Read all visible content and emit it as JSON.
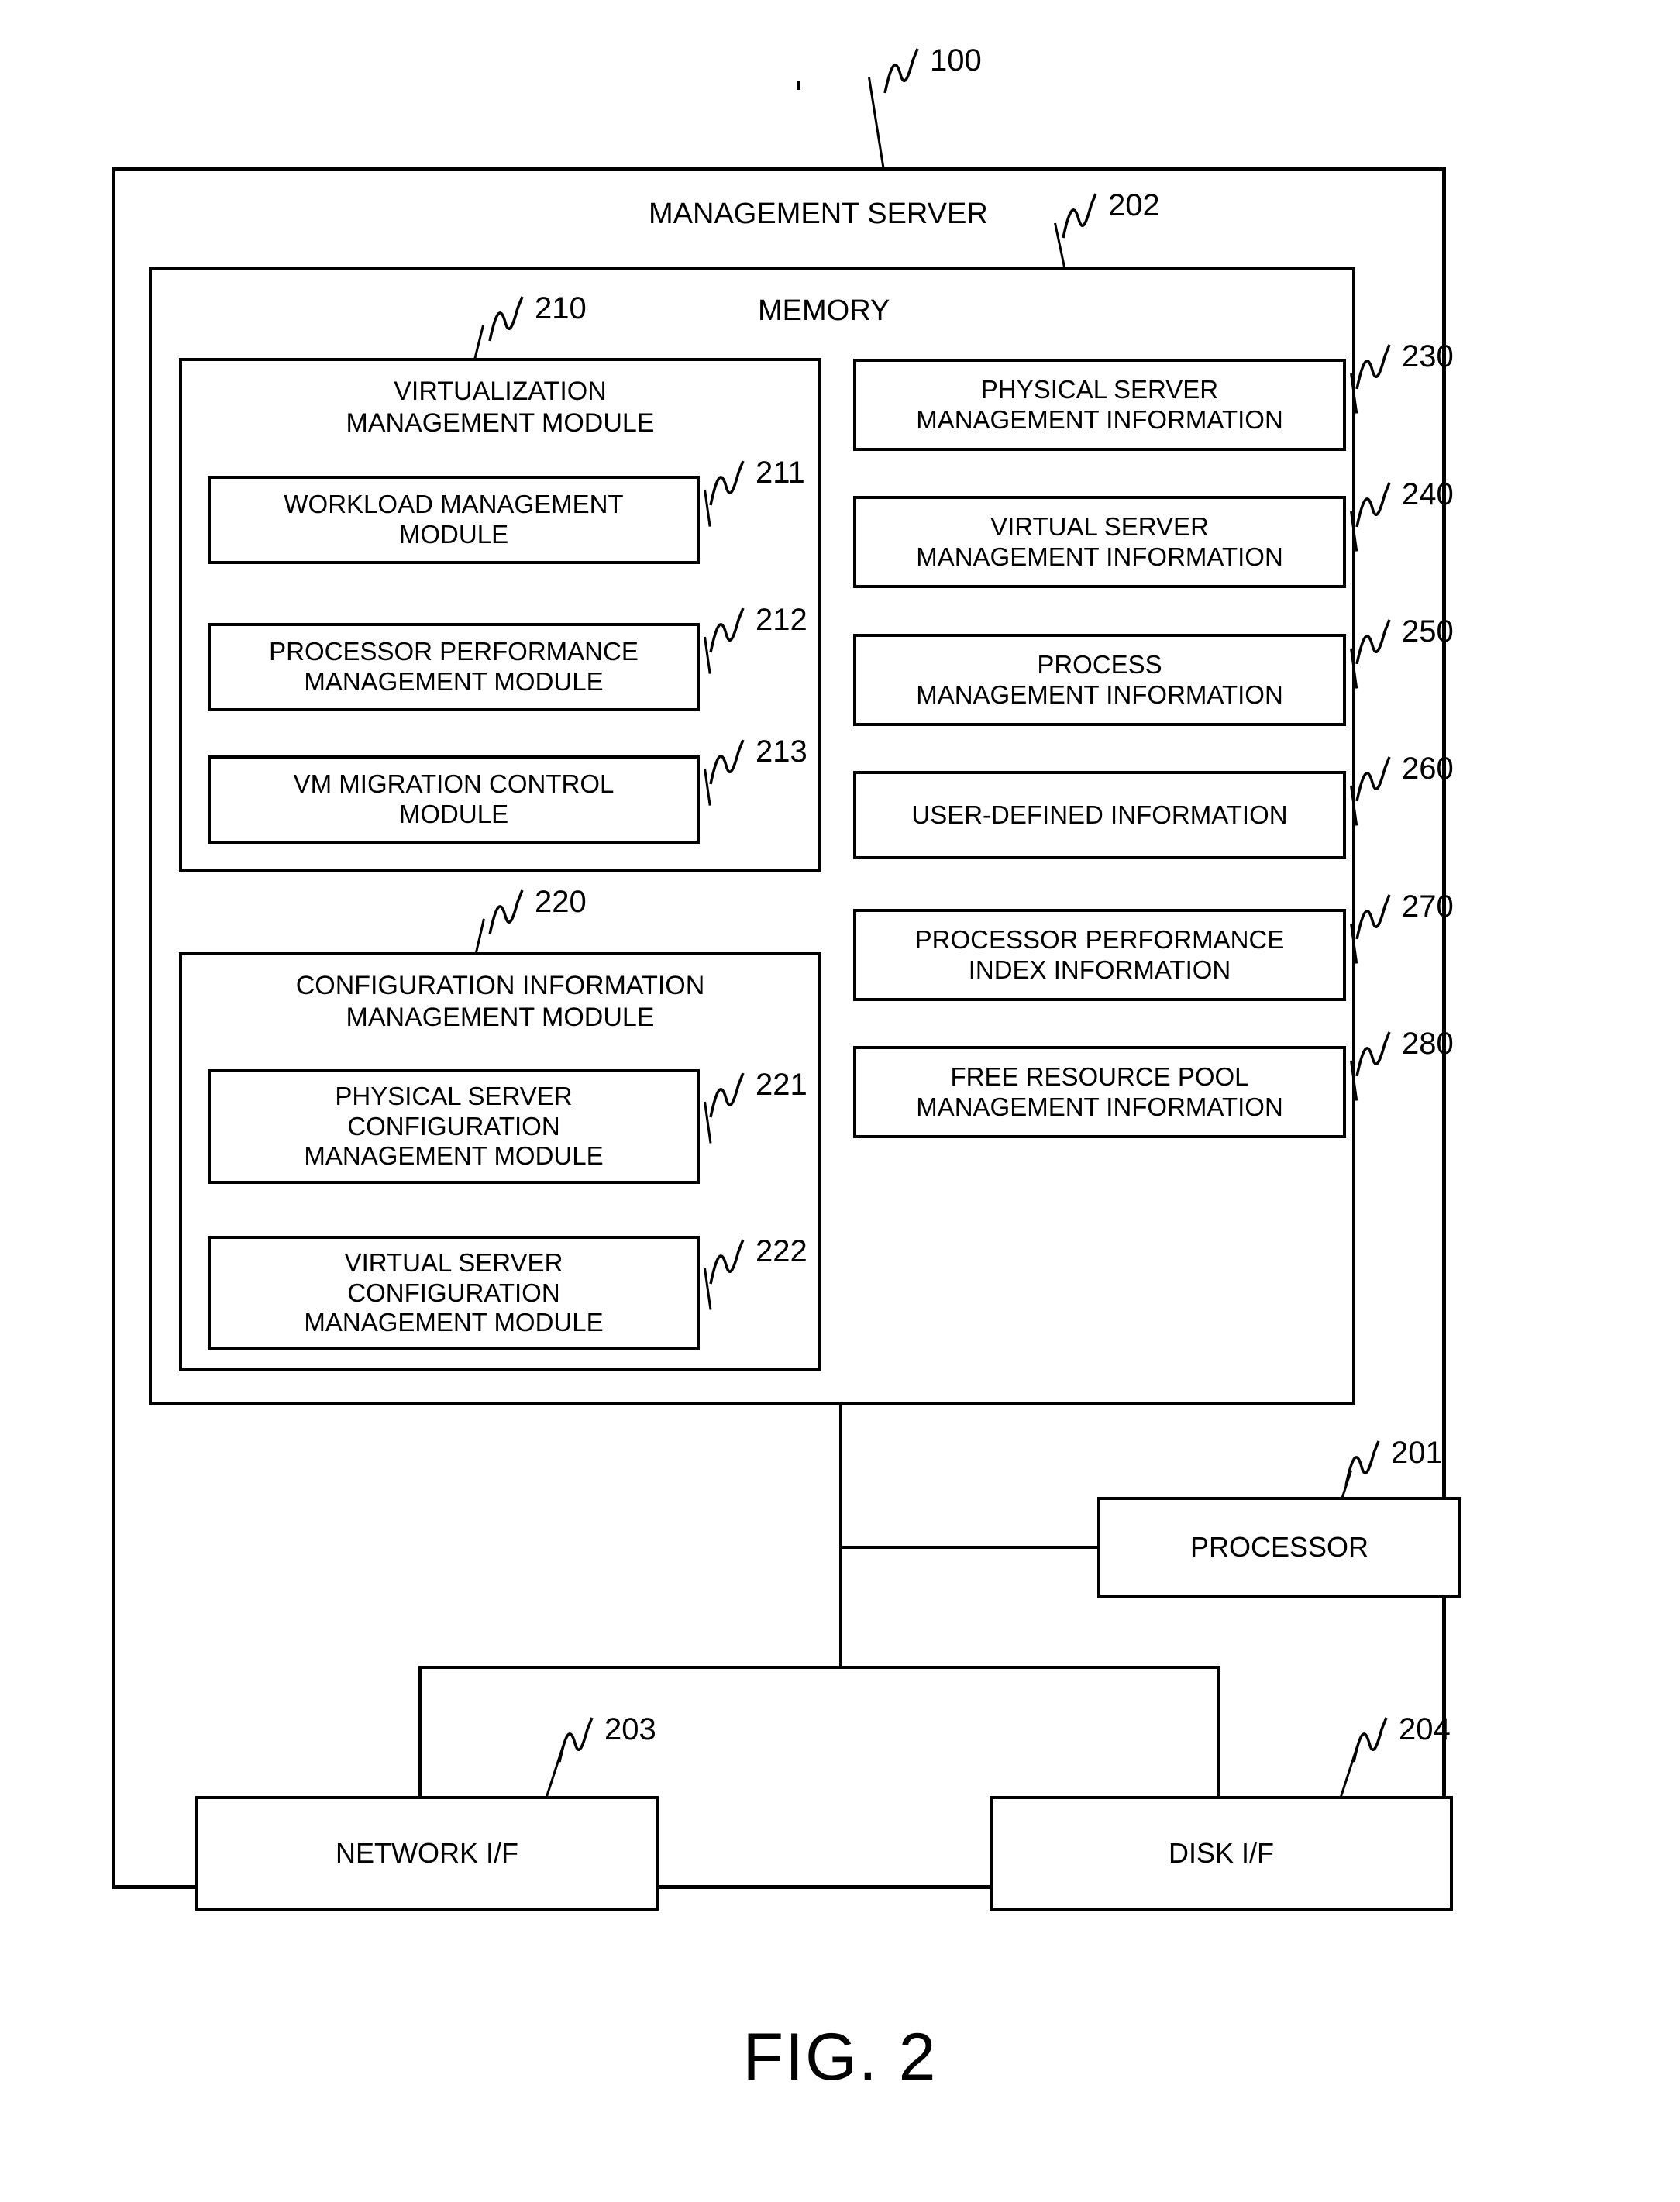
{
  "figure": {
    "caption": "FIG. 2",
    "system_ref": "100"
  },
  "system": {
    "title": "MANAGEMENT SERVER",
    "ref": "100"
  },
  "memory": {
    "title": "MEMORY",
    "ref": "202"
  },
  "modules": {
    "virtualization": {
      "title": "VIRTUALIZATION\nMANAGEMENT MODULE",
      "ref": "210",
      "children": [
        {
          "label": "WORKLOAD MANAGEMENT\nMODULE",
          "ref": "211"
        },
        {
          "label": "PROCESSOR PERFORMANCE\nMANAGEMENT MODULE",
          "ref": "212"
        },
        {
          "label": "VM MIGRATION CONTROL\nMODULE",
          "ref": "213"
        }
      ]
    },
    "configuration": {
      "title": "CONFIGURATION INFORMATION\nMANAGEMENT MODULE",
      "ref": "220",
      "children": [
        {
          "label": "PHYSICAL SERVER\nCONFIGURATION\nMANAGEMENT MODULE",
          "ref": "221"
        },
        {
          "label": "VIRTUAL SERVER\nCONFIGURATION\nMANAGEMENT MODULE",
          "ref": "222"
        }
      ]
    }
  },
  "information_items": [
    {
      "label": "PHYSICAL SERVER\nMANAGEMENT INFORMATION",
      "ref": "230"
    },
    {
      "label": "VIRTUAL SERVER\nMANAGEMENT INFORMATION",
      "ref": "240"
    },
    {
      "label": "PROCESS\nMANAGEMENT INFORMATION",
      "ref": "250"
    },
    {
      "label": "USER-DEFINED INFORMATION",
      "ref": "260"
    },
    {
      "label": "PROCESSOR PERFORMANCE\nINDEX INFORMATION",
      "ref": "270"
    },
    {
      "label": "FREE RESOURCE POOL\nMANAGEMENT INFORMATION",
      "ref": "280"
    }
  ],
  "hardware": [
    {
      "label": "PROCESSOR",
      "ref": "201"
    },
    {
      "label": "NETWORK I/F",
      "ref": "203"
    },
    {
      "label": "DISK I/F",
      "ref": "204"
    }
  ],
  "colors": {
    "line": "#000000",
    "background": "#ffffff"
  }
}
